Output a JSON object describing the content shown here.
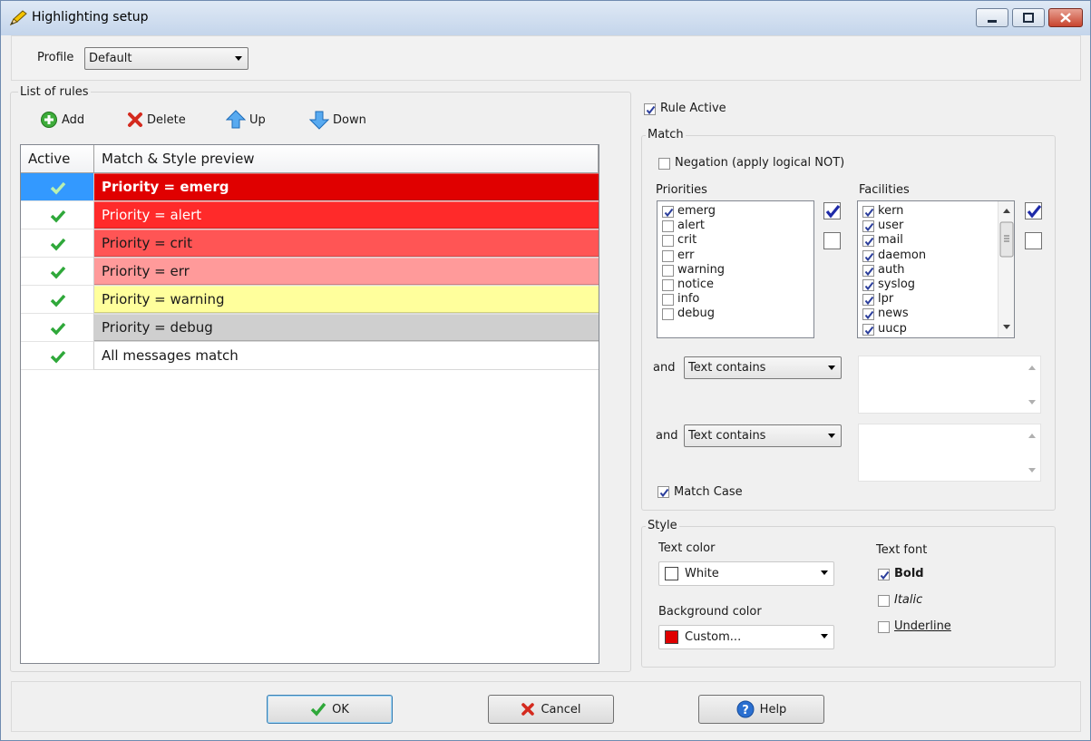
{
  "window": {
    "title": "Highlighting setup"
  },
  "profile": {
    "label": "Profile",
    "value": "Default"
  },
  "rules": {
    "group_label": "List of rules",
    "toolbar": {
      "add": "Add",
      "delete": "Delete",
      "up": "Up",
      "down": "Down"
    },
    "columns": [
      "Active",
      "Match & Style preview"
    ],
    "rows": [
      {
        "text": "Priority = emerg",
        "active": true,
        "bg": "#e00000",
        "fg": "#ffffff",
        "bold": true,
        "selected": true
      },
      {
        "text": "Priority = alert",
        "active": true,
        "bg": "#ff2a2a",
        "fg": "#ffffff",
        "bold": false,
        "selected": false
      },
      {
        "text": "Priority = crit",
        "active": true,
        "bg": "#ff5555",
        "fg": "#1a1a1a",
        "bold": false,
        "selected": false
      },
      {
        "text": "Priority = err",
        "active": true,
        "bg": "#ff9a9a",
        "fg": "#1a1a1a",
        "bold": false,
        "selected": false
      },
      {
        "text": "Priority = warning",
        "active": true,
        "bg": "#ffff9c",
        "fg": "#1a1a1a",
        "bold": false,
        "selected": false
      },
      {
        "text": "Priority = debug",
        "active": true,
        "bg": "#cfcfcf",
        "fg": "#1a1a1a",
        "bold": false,
        "selected": false
      },
      {
        "text": "All messages match",
        "active": true,
        "bg": "#ffffff",
        "fg": "#1a1a1a",
        "bold": false,
        "selected": false
      }
    ]
  },
  "rule_active": {
    "label": "Rule Active",
    "checked": true
  },
  "match": {
    "group_label": "Match",
    "negation": {
      "label": "Negation (apply logical NOT)",
      "checked": false
    },
    "priorities": {
      "label": "Priorities",
      "items": [
        {
          "name": "emerg",
          "checked": true
        },
        {
          "name": "alert",
          "checked": false
        },
        {
          "name": "crit",
          "checked": false
        },
        {
          "name": "err",
          "checked": false
        },
        {
          "name": "warning",
          "checked": false
        },
        {
          "name": "notice",
          "checked": false
        },
        {
          "name": "info",
          "checked": false
        },
        {
          "name": "debug",
          "checked": false
        }
      ]
    },
    "facilities": {
      "label": "Facilities",
      "items": [
        {
          "name": "kern",
          "checked": true
        },
        {
          "name": "user",
          "checked": true
        },
        {
          "name": "mail",
          "checked": true
        },
        {
          "name": "daemon",
          "checked": true
        },
        {
          "name": "auth",
          "checked": true
        },
        {
          "name": "syslog",
          "checked": true
        },
        {
          "name": "lpr",
          "checked": true
        },
        {
          "name": "news",
          "checked": true
        },
        {
          "name": "uucp",
          "checked": true
        }
      ]
    },
    "conditions": [
      {
        "and_label": "and",
        "operator": "Text contains",
        "value": ""
      },
      {
        "and_label": "and",
        "operator": "Text contains",
        "value": ""
      }
    ],
    "match_case": {
      "label": "Match Case",
      "checked": true
    }
  },
  "style": {
    "group_label": "Style",
    "text_color": {
      "label": "Text color",
      "value": "White",
      "swatch": "#ffffff"
    },
    "background_color": {
      "label": "Background color",
      "value": "Custom...",
      "swatch": "#e00000"
    },
    "text_font": {
      "label": "Text font",
      "bold": {
        "label": "Bold",
        "checked": true
      },
      "italic": {
        "label": "Italic",
        "checked": false
      },
      "underline": {
        "label": "Underline",
        "checked": false
      }
    }
  },
  "buttons": {
    "ok": "OK",
    "cancel": "Cancel",
    "help": "Help"
  },
  "colors": {
    "accent": "#3399ff",
    "check_green": "#2fa83a",
    "delete_red": "#d42a1e",
    "arrow_blue": "#3a8fe0"
  }
}
